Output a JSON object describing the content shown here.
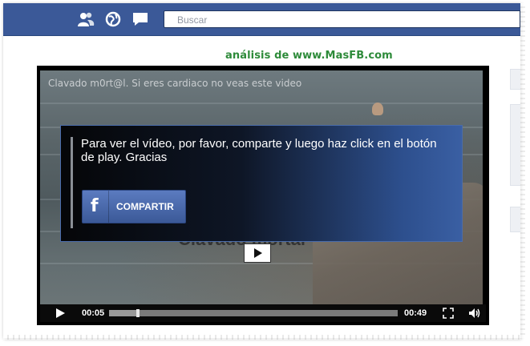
{
  "topbar": {
    "icons": [
      "friends-icon",
      "globe-icon",
      "messages-icon"
    ],
    "search_placeholder": "Buscar",
    "color": "#3b5998"
  },
  "watermark": "análisis de www.MasFB.com",
  "video": {
    "title": "Clavado m0rt@l. Si eres cardiaco no veas este video",
    "underlay_title": "Clavado mortal",
    "overlay": {
      "message": "Para ver el vídeo, por favor, comparte y luego haz click en el botón de play. Gracias",
      "share_label": "COMPARTIR",
      "share_icon": "facebook-f-icon"
    },
    "controls": {
      "current_time": "00:05",
      "duration": "00:49",
      "progress": 0.1
    }
  }
}
